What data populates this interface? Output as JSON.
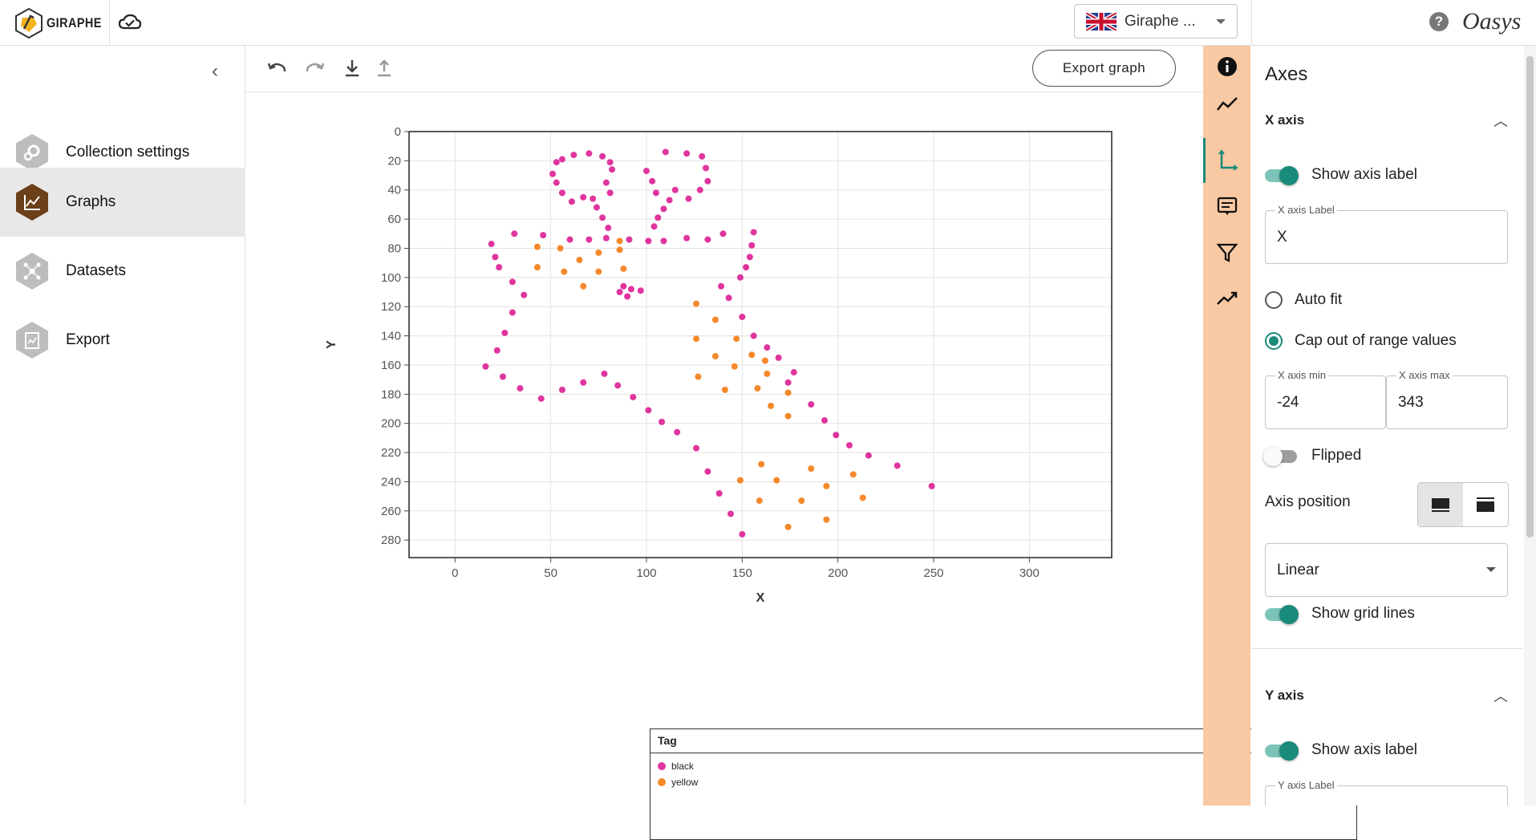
{
  "app": {
    "logo_text": "GIRAPHE",
    "language_selector": "Giraphe ...",
    "brand": "Oasys"
  },
  "sidebar": {
    "items": [
      {
        "label": "Collection settings",
        "icon": "gear-icon"
      },
      {
        "label": "Graphs",
        "icon": "chart-icon",
        "active": true
      },
      {
        "label": "Datasets",
        "icon": "network-icon"
      },
      {
        "label": "Export",
        "icon": "export-icon"
      }
    ]
  },
  "toolbar": {
    "export_label": "Export graph"
  },
  "panel": {
    "title": "Axes",
    "x_axis": {
      "heading": "X axis",
      "show_axis_label": "Show axis label",
      "label_field_title": "X axis Label",
      "label_value": "X",
      "auto_fit": "Auto fit",
      "cap_range": "Cap out of range values",
      "min_title": "X axis min",
      "min_value": "-24",
      "max_title": "X axis max",
      "max_value": "343",
      "flipped": "Flipped",
      "axis_position": "Axis position",
      "scale": "Linear",
      "show_grid": "Show grid lines"
    },
    "y_axis": {
      "heading": "Y axis",
      "show_axis_label": "Show axis label",
      "label_field_title": "Y axis Label"
    }
  },
  "legend": {
    "title": "Tag",
    "entries": [
      {
        "name": "black",
        "color": "#e0359e"
      },
      {
        "name": "yellow",
        "color": "#f5892b"
      }
    ]
  },
  "chart_data": {
    "type": "scatter",
    "xlabel": "X",
    "ylabel": "Y",
    "xlim": [
      -24,
      343
    ],
    "ylim": [
      0,
      292
    ],
    "y_flipped": true,
    "x_ticks": [
      0,
      50,
      100,
      150,
      200,
      250,
      300
    ],
    "y_ticks": [
      0,
      20,
      40,
      60,
      80,
      100,
      120,
      140,
      160,
      180,
      200,
      220,
      240,
      260,
      280
    ],
    "grid": true,
    "series": [
      {
        "name": "black",
        "color": "#e0359e",
        "points": [
          [
            53,
            21
          ],
          [
            56,
            19
          ],
          [
            62,
            16
          ],
          [
            70,
            15
          ],
          [
            77,
            17
          ],
          [
            81,
            21
          ],
          [
            82,
            26
          ],
          [
            51,
            29
          ],
          [
            53,
            35
          ],
          [
            56,
            42
          ],
          [
            61,
            48
          ],
          [
            72,
            46
          ],
          [
            81,
            42
          ],
          [
            79,
            35
          ],
          [
            74,
            52
          ],
          [
            77,
            59
          ],
          [
            80,
            66
          ],
          [
            79,
            73
          ],
          [
            70,
            74
          ],
          [
            60,
            74
          ],
          [
            91,
            74
          ],
          [
            67,
            45
          ],
          [
            88,
            106
          ],
          [
            92,
            108
          ],
          [
            86,
            110
          ],
          [
            97,
            109
          ],
          [
            90,
            113
          ],
          [
            100,
            27
          ],
          [
            103,
            34
          ],
          [
            105,
            42
          ],
          [
            115,
            40
          ],
          [
            112,
            47
          ],
          [
            109,
            53
          ],
          [
            106,
            59
          ],
          [
            104,
            65
          ],
          [
            101,
            75
          ],
          [
            109,
            75
          ],
          [
            110,
            14
          ],
          [
            121,
            15
          ],
          [
            129,
            17
          ],
          [
            131,
            25
          ],
          [
            132,
            34
          ],
          [
            128,
            40
          ],
          [
            122,
            46
          ],
          [
            121,
            73
          ],
          [
            132,
            74
          ],
          [
            140,
            70
          ],
          [
            156,
            69
          ],
          [
            155,
            78
          ],
          [
            154,
            86
          ],
          [
            152,
            93
          ],
          [
            149,
            100
          ],
          [
            139,
            106
          ],
          [
            143,
            114
          ],
          [
            150,
            127
          ],
          [
            156,
            140
          ],
          [
            163,
            148
          ],
          [
            169,
            155
          ],
          [
            177,
            165
          ],
          [
            174,
            172
          ],
          [
            186,
            187
          ],
          [
            193,
            198
          ],
          [
            199,
            208
          ],
          [
            206,
            215
          ],
          [
            216,
            222
          ],
          [
            231,
            229
          ],
          [
            249,
            243
          ],
          [
            19,
            77
          ],
          [
            21,
            86
          ],
          [
            23,
            93
          ],
          [
            31,
            70
          ],
          [
            46,
            71
          ],
          [
            30,
            103
          ],
          [
            36,
            112
          ],
          [
            30,
            124
          ],
          [
            26,
            138
          ],
          [
            22,
            150
          ],
          [
            16,
            161
          ],
          [
            25,
            168
          ],
          [
            34,
            176
          ],
          [
            45,
            183
          ],
          [
            56,
            177
          ],
          [
            67,
            172
          ],
          [
            78,
            166
          ],
          [
            85,
            174
          ],
          [
            93,
            182
          ],
          [
            101,
            191
          ],
          [
            108,
            199
          ],
          [
            116,
            206
          ],
          [
            126,
            217
          ],
          [
            132,
            233
          ],
          [
            138,
            248
          ],
          [
            144,
            262
          ],
          [
            150,
            276
          ]
        ]
      },
      {
        "name": "yellow",
        "color": "#f5892b",
        "points": [
          [
            43,
            79
          ],
          [
            43,
            93
          ],
          [
            55,
            80
          ],
          [
            57,
            96
          ],
          [
            65,
            88
          ],
          [
            67,
            106
          ],
          [
            75,
            83
          ],
          [
            75,
            96
          ],
          [
            86,
            81
          ],
          [
            88,
            94
          ],
          [
            86,
            75
          ],
          [
            126,
            118
          ],
          [
            136,
            129
          ],
          [
            126,
            142
          ],
          [
            147,
            142
          ],
          [
            136,
            154
          ],
          [
            155,
            153
          ],
          [
            127,
            168
          ],
          [
            141,
            177
          ],
          [
            146,
            161
          ],
          [
            162,
            157
          ],
          [
            163,
            166
          ],
          [
            158,
            176
          ],
          [
            165,
            188
          ],
          [
            174,
            179
          ],
          [
            174,
            195
          ],
          [
            160,
            228
          ],
          [
            149,
            239
          ],
          [
            168,
            239
          ],
          [
            159,
            253
          ],
          [
            181,
            253
          ],
          [
            186,
            231
          ],
          [
            194,
            243
          ],
          [
            208,
            235
          ],
          [
            213,
            251
          ],
          [
            194,
            266
          ],
          [
            174,
            271
          ]
        ]
      }
    ]
  }
}
